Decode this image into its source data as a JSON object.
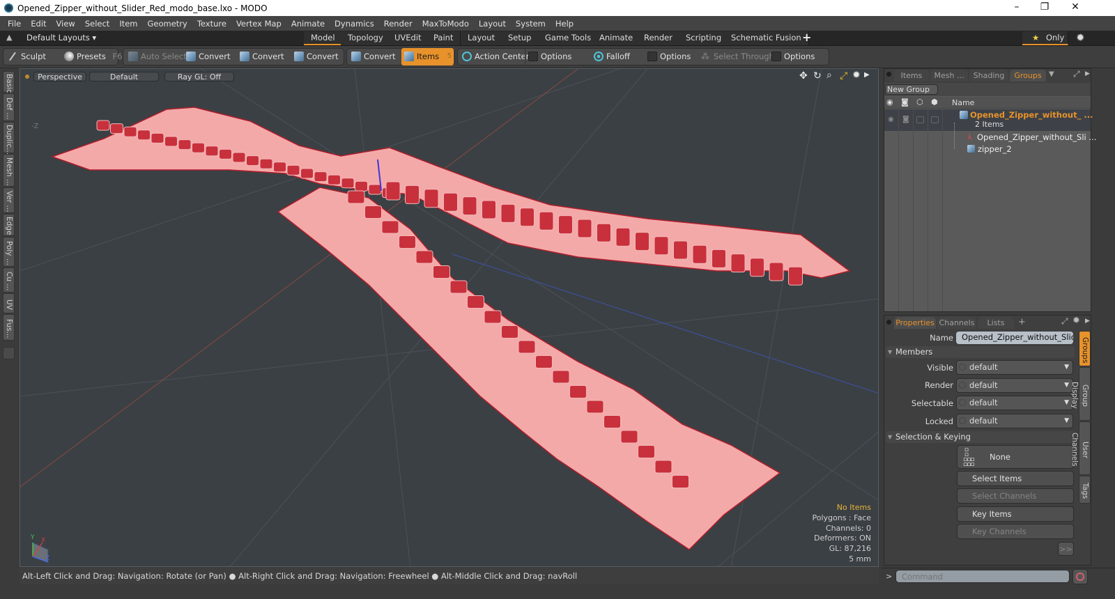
{
  "window": {
    "title": "Opened_Zipper_without_Slider_Red_modo_base.lxo - MODO",
    "controls": {
      "minimize": "–",
      "maximize": "❐",
      "close": "✕"
    }
  },
  "menu": [
    "File",
    "Edit",
    "View",
    "Select",
    "Item",
    "Geometry",
    "Texture",
    "Vertex Map",
    "Animate",
    "Dynamics",
    "Render",
    "MaxToModo",
    "Layout",
    "System",
    "Help"
  ],
  "layout_bar": {
    "layouts_dropdown": "Default Layouts ▾",
    "tabs": [
      "Model",
      "Topology",
      "UVEdit",
      "Paint",
      "Layout",
      "Setup",
      "Game Tools",
      "Animate",
      "Render",
      "Scripting",
      "Schematic Fusion"
    ],
    "active_tab": "Model",
    "add_tab": "+",
    "only_label": "Only",
    "star": "★"
  },
  "toolbar": {
    "sculpt": "Sculpt",
    "presets": "Presets",
    "presets_key": "F6",
    "auto_select": "Auto Select",
    "convert1": "Convert",
    "convert2": "Convert",
    "convert3": "Convert",
    "convert4": "Convert",
    "items": "Items",
    "items_key": "5",
    "action_center": "Action Center",
    "options1": "Options",
    "falloff": "Falloff",
    "options2": "Options",
    "select_through": "Select Through",
    "options3": "Options"
  },
  "left_tabs": [
    "Basic",
    "Def ...",
    "Duplic...",
    "Mesh ...",
    "Ver ...",
    "Edge",
    "Poly ...",
    "Cu ...",
    "UV",
    "Fus..."
  ],
  "viewport": {
    "view_mode": "Perspective",
    "shading": "Default",
    "raygl": "Ray GL: Off",
    "axis_label": "-Z",
    "info": {
      "selection": "No Items",
      "polygons": "Polygons : Face",
      "channels": "Channels: 0",
      "deformers": "Deformers: ON",
      "gl": "GL: 87,216",
      "scale": "5 mm"
    },
    "gizmo": {
      "x": "X",
      "y": "Y",
      "z": "Z"
    },
    "colors": {
      "mesh": "#f4a3a3",
      "edge": "#b01e2a",
      "teeth": "#c8303c",
      "bg": "#3b4045"
    }
  },
  "status_bar": "Alt-Left Click and Drag: Navigation: Rotate (or Pan) ● Alt-Right Click and Drag: Navigation: Freewheel ● Alt-Middle Click and Drag: navRoll",
  "groups_panel": {
    "tabs": [
      "Items",
      "Mesh ...",
      "Shading",
      "Groups"
    ],
    "active_tab": "Groups",
    "new_group": "New Group",
    "name_header": "Name",
    "group": {
      "name": "Opened_Zipper_without_ ...",
      "count": "2 Items",
      "children": [
        "Opened_Zipper_without_Sli ...",
        "zipper_2"
      ]
    }
  },
  "properties_panel": {
    "tabs": [
      "Properties",
      "Channels",
      "Lists"
    ],
    "active_tab": "Properties",
    "add_tab": "+",
    "name_label": "Name",
    "name_value": "Opened_Zipper_without_Slider_R",
    "members_section": "Members",
    "members": [
      {
        "label": "Visible",
        "value": "default"
      },
      {
        "label": "Render",
        "value": "default"
      },
      {
        "label": "Selectable",
        "value": "default"
      },
      {
        "label": "Locked",
        "value": "default"
      }
    ],
    "selection_section": "Selection & Keying",
    "none_label": "None",
    "buttons": [
      "Select Items",
      "Select Channels",
      "Key Items",
      "Key Channels"
    ],
    "more": ">>",
    "side_tabs": [
      "Groups",
      "Group Display",
      "User Channels",
      "Tags"
    ],
    "active_side_tab": "Groups"
  },
  "command": {
    "prompt": ">",
    "placeholder": "Command"
  },
  "accent": "#e8922b"
}
